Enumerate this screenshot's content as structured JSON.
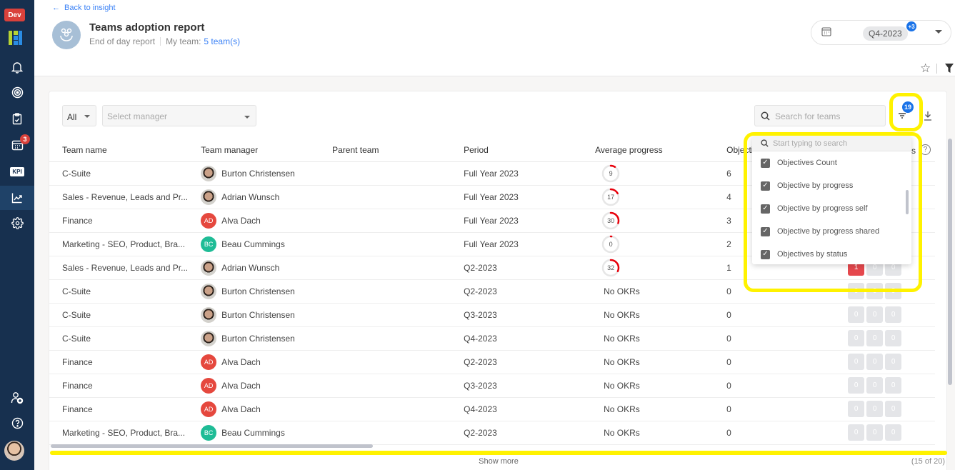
{
  "sidebar": {
    "env_badge": "Dev",
    "items": [
      {
        "name": "notifications",
        "icon": "bell-icon"
      },
      {
        "name": "objectives",
        "icon": "target-icon"
      },
      {
        "name": "tasks",
        "icon": "clipboard-icon"
      },
      {
        "name": "meetings",
        "icon": "calendar-icon",
        "badge": "3"
      },
      {
        "name": "kpi",
        "icon": "kpi-icon",
        "label": "KPI"
      },
      {
        "name": "insights",
        "icon": "chart-icon",
        "active": true
      },
      {
        "name": "settings",
        "icon": "gear-icon"
      },
      {
        "name": "invite",
        "icon": "add-user-icon"
      },
      {
        "name": "help",
        "icon": "help-icon"
      }
    ]
  },
  "header": {
    "back_label": "Back to insight",
    "title": "Teams adoption report",
    "subtitle": "End of day report",
    "my_team_label": "My team:",
    "my_team_link": "5 team(s)",
    "period": "Q4-2023",
    "period_more": "+3"
  },
  "filters": {
    "scope": "All",
    "manager_placeholder": "Select manager",
    "search_placeholder": "Search for teams",
    "column_count_badge": "19"
  },
  "table": {
    "columns": [
      "Team name",
      "Team manager",
      "Parent team",
      "Period",
      "Average progress",
      "Objectives C",
      "s"
    ],
    "rows": [
      {
        "team": "C-Suite",
        "manager": "Burton Christensen",
        "avatar": "photo",
        "parent": "",
        "period": "Full Year 2023",
        "progress": 9,
        "objectives": "6",
        "status": [
          "",
          "",
          ""
        ]
      },
      {
        "team": "Sales - Revenue, Leads and Pr...",
        "manager": "Adrian Wunsch",
        "avatar": "photo",
        "parent": "",
        "period": "Full Year 2023",
        "progress": 17,
        "objectives": "4",
        "status": [
          "",
          "",
          ""
        ]
      },
      {
        "team": "Finance",
        "manager": "Alva Dach",
        "avatar": "AD",
        "avatar_color": "#e5483e",
        "parent": "",
        "period": "Full Year 2023",
        "progress": 30,
        "objectives": "3",
        "status": [
          "",
          "",
          ""
        ]
      },
      {
        "team": "Marketing - SEO, Product, Bra...",
        "manager": "Beau Cummings",
        "avatar": "BC",
        "avatar_color": "#1fbc96",
        "parent": "",
        "period": "Full Year 2023",
        "progress": 0,
        "objectives": "2",
        "status": [
          "",
          "",
          ""
        ]
      },
      {
        "team": "Sales - Revenue, Leads and Pr...",
        "manager": "Adrian Wunsch",
        "avatar": "photo",
        "parent": "",
        "period": "Q2-2023",
        "progress": 32,
        "objectives": "1",
        "status": [
          "1",
          "0",
          "0"
        ]
      },
      {
        "team": "C-Suite",
        "manager": "Burton Christensen",
        "avatar": "photo",
        "parent": "",
        "period": "Q2-2023",
        "progress_text": "No OKRs",
        "objectives": "0",
        "status": [
          "0",
          "0",
          "0"
        ]
      },
      {
        "team": "C-Suite",
        "manager": "Burton Christensen",
        "avatar": "photo",
        "parent": "",
        "period": "Q3-2023",
        "progress_text": "No OKRs",
        "objectives": "0",
        "status": [
          "0",
          "0",
          "0"
        ]
      },
      {
        "team": "C-Suite",
        "manager": "Burton Christensen",
        "avatar": "photo",
        "parent": "",
        "period": "Q4-2023",
        "progress_text": "No OKRs",
        "objectives": "0",
        "status": [
          "0",
          "0",
          "0"
        ]
      },
      {
        "team": "Finance",
        "manager": "Alva Dach",
        "avatar": "AD",
        "avatar_color": "#e5483e",
        "parent": "",
        "period": "Q2-2023",
        "progress_text": "No OKRs",
        "objectives": "0",
        "status": [
          "0",
          "0",
          "0"
        ]
      },
      {
        "team": "Finance",
        "manager": "Alva Dach",
        "avatar": "AD",
        "avatar_color": "#e5483e",
        "parent": "",
        "period": "Q3-2023",
        "progress_text": "No OKRs",
        "objectives": "0",
        "status": [
          "0",
          "0",
          "0"
        ]
      },
      {
        "team": "Finance",
        "manager": "Alva Dach",
        "avatar": "AD",
        "avatar_color": "#e5483e",
        "parent": "",
        "period": "Q4-2023",
        "progress_text": "No OKRs",
        "objectives": "0",
        "status": [
          "0",
          "0",
          "0"
        ]
      },
      {
        "team": "Marketing - SEO, Product, Bra...",
        "manager": "Beau Cummings",
        "avatar": "BC",
        "avatar_color": "#1fbc96",
        "parent": "",
        "period": "Q2-2023",
        "progress_text": "No OKRs",
        "objectives": "0",
        "status": [
          "0",
          "0",
          "0"
        ]
      }
    ],
    "show_more": "Show more",
    "count": "(15 of 20)"
  },
  "column_picker": {
    "search_placeholder": "Start typing to search",
    "items": [
      {
        "label": "Objectives Count",
        "checked": true
      },
      {
        "label": "Objective by progress",
        "checked": true
      },
      {
        "label": "Objective by progress self",
        "checked": true
      },
      {
        "label": "Objective by progress shared",
        "checked": true
      },
      {
        "label": "Objectives by status",
        "checked": true
      }
    ]
  },
  "colors": {
    "sidebar_bg": "#17304f",
    "accent": "#3b82f6",
    "badge_blue": "#1a73e8",
    "progress_red": "#e8000b",
    "status_red": "#e5484d",
    "highlight": "#fff200"
  }
}
